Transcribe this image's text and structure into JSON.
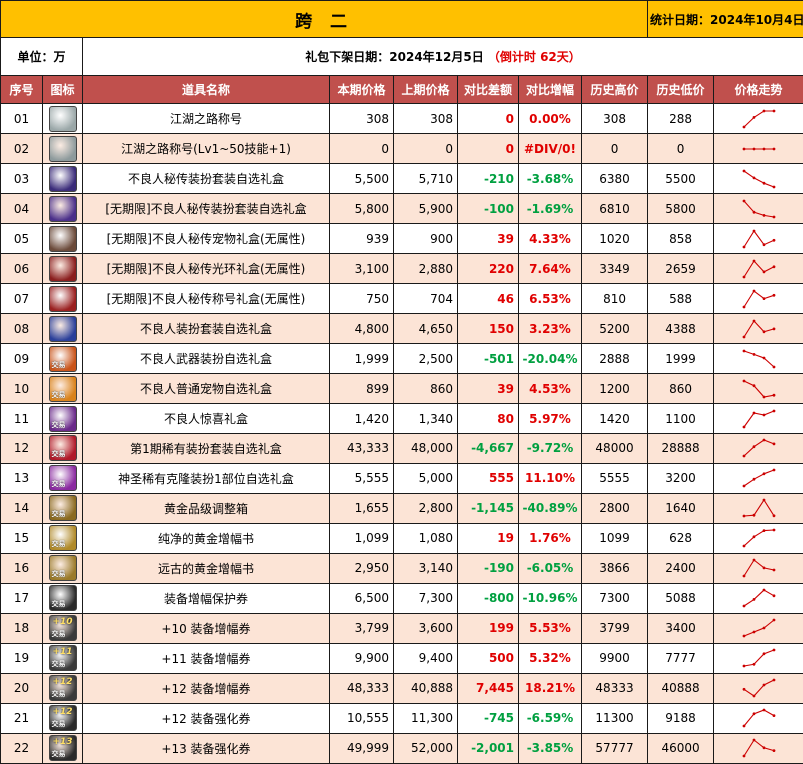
{
  "header": {
    "title": "跨 二",
    "stat_date": "统计日期：2024年10月4日",
    "unit": "单位：万",
    "release_label": "礼包下架日期：2024年12月5日",
    "countdown": "（倒计时 62天）"
  },
  "columns": [
    "序号",
    "图标",
    "道具名称",
    "本期价格",
    "上期价格",
    "对比差额",
    "对比增幅",
    "历史高价",
    "历史低价",
    "价格走势"
  ],
  "colors": {
    "title_bg": "#FFC000",
    "header_bg": "#C0504D",
    "stripe_bg": "#FCE4D6",
    "up": "#e00000",
    "down": "#00a040",
    "spark": "#cc0000"
  },
  "rows": [
    {
      "no": "01",
      "icon": "jianghu-title-icon",
      "icon_bg": "#9aa7a8",
      "tag": "",
      "lvl": "",
      "name": "江湖之路称号",
      "cur": "308",
      "prev": "308",
      "diff": "0",
      "pct": "0.00%",
      "dir": "zero",
      "high": "308",
      "low": "288",
      "spark": [
        288,
        300,
        308,
        308
      ]
    },
    {
      "no": "02",
      "icon": "jianghu-title-skill-icon",
      "icon_bg": "#8d9a9c",
      "tag": "",
      "lvl": "",
      "name": "江湖之路称号(Lv1~50技能+1)",
      "cur": "0",
      "prev": "0",
      "diff": "0",
      "pct": "#DIV/0!",
      "dir": "zero",
      "high": "0",
      "low": "0",
      "spark": [
        0,
        0,
        0,
        0
      ]
    },
    {
      "no": "03",
      "icon": "delinquent-avatar-box-icon",
      "icon_bg": "#3b2c7a",
      "tag": "",
      "lvl": "",
      "name": "不良人秘传装扮套装自选礼盒",
      "cur": "5,500",
      "prev": "5,710",
      "diff": "-210",
      "pct": "-3.68%",
      "dir": "down",
      "high": "6380",
      "low": "5500",
      "spark": [
        6380,
        6000,
        5710,
        5500
      ]
    },
    {
      "no": "04",
      "icon": "delinquent-avatar-box-icon",
      "icon_bg": "#4a2f8a",
      "tag": "",
      "lvl": "",
      "name": "[无期限]不良人秘传装扮套装自选礼盒",
      "cur": "5,800",
      "prev": "5,900",
      "diff": "-100",
      "pct": "-1.69%",
      "dir": "down",
      "high": "6810",
      "low": "5800",
      "spark": [
        6810,
        6100,
        5900,
        5800
      ]
    },
    {
      "no": "05",
      "icon": "delinquent-pet-box-icon",
      "icon_bg": "#6b4a3a",
      "tag": "",
      "lvl": "",
      "name": "[无期限]不良人秘传宠物礼盒(无属性)",
      "cur": "939",
      "prev": "900",
      "diff": "39",
      "pct": "4.33%",
      "dir": "up",
      "high": "1020",
      "low": "858",
      "spark": [
        880,
        1020,
        900,
        939
      ]
    },
    {
      "no": "06",
      "icon": "delinquent-aura-box-icon",
      "icon_bg": "#8a1e1e",
      "tag": "",
      "lvl": "",
      "name": "[无期限]不良人秘传光环礼盒(无属性)",
      "cur": "3,100",
      "prev": "2,880",
      "diff": "220",
      "pct": "7.64%",
      "dir": "up",
      "high": "3349",
      "low": "2659",
      "spark": [
        2659,
        3349,
        2880,
        3100
      ]
    },
    {
      "no": "07",
      "icon": "delinquent-title-box-icon",
      "icon_bg": "#9a2020",
      "tag": "",
      "lvl": "",
      "name": "[无期限]不良人秘传称号礼盒(无属性)",
      "cur": "750",
      "prev": "704",
      "diff": "46",
      "pct": "6.53%",
      "dir": "up",
      "high": "810",
      "low": "588",
      "spark": [
        588,
        810,
        704,
        750
      ]
    },
    {
      "no": "08",
      "icon": "delinquent-outfit-box-icon",
      "icon_bg": "#2a3f9a",
      "tag": "",
      "lvl": "",
      "name": "不良人装扮套装自选礼盒",
      "cur": "4,800",
      "prev": "4,650",
      "diff": "150",
      "pct": "3.23%",
      "dir": "up",
      "high": "5200",
      "low": "4388",
      "spark": [
        4388,
        5200,
        4650,
        4800
      ]
    },
    {
      "no": "09",
      "icon": "delinquent-weapon-box-icon",
      "icon_bg": "#c9541a",
      "tag": "交易",
      "lvl": "",
      "name": "不良人武器装扮自选礼盒",
      "cur": "1,999",
      "prev": "2,500",
      "diff": "-501",
      "pct": "-20.04%",
      "dir": "down",
      "high": "2888",
      "low": "1999",
      "spark": [
        2888,
        2700,
        2500,
        1999
      ]
    },
    {
      "no": "10",
      "icon": "delinquent-normal-pet-box-icon",
      "icon_bg": "#d9821a",
      "tag": "交易",
      "lvl": "",
      "name": "不良人普通宠物自选礼盒",
      "cur": "899",
      "prev": "860",
      "diff": "39",
      "pct": "4.53%",
      "dir": "up",
      "high": "1200",
      "low": "860",
      "spark": [
        1200,
        1100,
        860,
        899
      ]
    },
    {
      "no": "11",
      "icon": "delinquent-surprise-box-icon",
      "icon_bg": "#6a2a8a",
      "tag": "交易",
      "lvl": "",
      "name": "不良人惊喜礼盒",
      "cur": "1,420",
      "prev": "1,340",
      "diff": "80",
      "pct": "5.97%",
      "dir": "up",
      "high": "1420",
      "low": "1100",
      "spark": [
        1100,
        1380,
        1340,
        1420
      ]
    },
    {
      "no": "12",
      "icon": "rare-outfit-box-icon",
      "icon_bg": "#b01a2a",
      "tag": "交易",
      "lvl": "",
      "name": "第1期稀有装扮套装自选礼盒",
      "cur": "43,333",
      "prev": "48,000",
      "diff": "-4,667",
      "pct": "-9.72%",
      "dir": "down",
      "high": "48000",
      "low": "28888",
      "spark": [
        28888,
        40000,
        48000,
        43333
      ]
    },
    {
      "no": "13",
      "icon": "holy-rare-clone-box-icon",
      "icon_bg": "#8a2aa0",
      "tag": "交易",
      "lvl": "",
      "name": "神圣稀有克隆装扮1部位自选礼盒",
      "cur": "5,555",
      "prev": "5,000",
      "diff": "555",
      "pct": "11.10%",
      "dir": "up",
      "high": "5555",
      "low": "3200",
      "spark": [
        3200,
        4200,
        5000,
        5555
      ]
    },
    {
      "no": "14",
      "icon": "gold-grade-adjust-box-icon",
      "icon_bg": "#8a6a20",
      "tag": "交易",
      "lvl": "",
      "name": "黄金品级调整箱",
      "cur": "1,655",
      "prev": "2,800",
      "diff": "-1,145",
      "pct": "-40.89%",
      "dir": "down",
      "high": "2800",
      "low": "1640",
      "spark": [
        1640,
        1700,
        2800,
        1655
      ]
    },
    {
      "no": "15",
      "icon": "pure-gold-amplify-book-icon",
      "icon_bg": "#b08a2a",
      "tag": "交易",
      "lvl": "",
      "name": "纯净的黄金增幅书",
      "cur": "1,099",
      "prev": "1,080",
      "diff": "19",
      "pct": "1.76%",
      "dir": "up",
      "high": "1099",
      "low": "628",
      "spark": [
        628,
        900,
        1080,
        1099
      ]
    },
    {
      "no": "16",
      "icon": "ancient-gold-amplify-book-icon",
      "icon_bg": "#9a7a2a",
      "tag": "交易",
      "lvl": "",
      "name": "远古的黄金增幅书",
      "cur": "2,950",
      "prev": "3,140",
      "diff": "-190",
      "pct": "-6.05%",
      "dir": "down",
      "high": "3866",
      "low": "2400",
      "spark": [
        2400,
        3866,
        3140,
        2950
      ]
    },
    {
      "no": "17",
      "icon": "amplify-protection-ticket-icon",
      "icon_bg": "#2a2a2a",
      "tag": "交易",
      "lvl": "",
      "name": "装备增幅保护券",
      "cur": "6,500",
      "prev": "7,300",
      "diff": "-800",
      "pct": "-10.96%",
      "dir": "down",
      "high": "7300",
      "low": "5088",
      "spark": [
        5088,
        6000,
        7300,
        6500
      ]
    },
    {
      "no": "18",
      "icon": "plus10-amplify-ticket-icon",
      "icon_bg": "#3a3a3a",
      "tag": "交易",
      "lvl": "+10",
      "name": "+10 装备增幅券",
      "cur": "3,799",
      "prev": "3,600",
      "diff": "199",
      "pct": "5.53%",
      "dir": "up",
      "high": "3799",
      "low": "3400",
      "spark": [
        3400,
        3500,
        3600,
        3799
      ]
    },
    {
      "no": "19",
      "icon": "plus11-amplify-ticket-icon",
      "icon_bg": "#3a3a3a",
      "tag": "交易",
      "lvl": "+11",
      "name": "+11 装备增幅券",
      "cur": "9,900",
      "prev": "9,400",
      "diff": "500",
      "pct": "5.32%",
      "dir": "up",
      "high": "9900",
      "low": "7777",
      "spark": [
        7777,
        8000,
        9400,
        9900
      ]
    },
    {
      "no": "20",
      "icon": "plus12-amplify-ticket-icon",
      "icon_bg": "#3a3a3a",
      "tag": "交易",
      "lvl": "+12",
      "name": "+12 装备增幅券",
      "cur": "48,333",
      "prev": "40,888",
      "diff": "7,445",
      "pct": "18.21%",
      "dir": "up",
      "high": "48333",
      "low": "40888",
      "spark": [
        44000,
        40888,
        46000,
        48333
      ]
    },
    {
      "no": "21",
      "icon": "plus12-enhance-ticket-icon",
      "icon_bg": "#2a2a2a",
      "tag": "交易",
      "lvl": "+12",
      "name": "+12 装备强化券",
      "cur": "10,555",
      "prev": "11,300",
      "diff": "-745",
      "pct": "-6.59%",
      "dir": "down",
      "high": "11300",
      "low": "9188",
      "spark": [
        9188,
        10800,
        11300,
        10555
      ]
    },
    {
      "no": "22",
      "icon": "plus13-enhance-ticket-icon",
      "icon_bg": "#2a2a2a",
      "tag": "交易",
      "lvl": "+13",
      "name": "+13 装备强化券",
      "cur": "49,999",
      "prev": "52,000",
      "diff": "-2,001",
      "pct": "-3.85%",
      "dir": "down",
      "high": "57777",
      "low": "46000",
      "spark": [
        46000,
        57777,
        52000,
        49999
      ]
    }
  ]
}
